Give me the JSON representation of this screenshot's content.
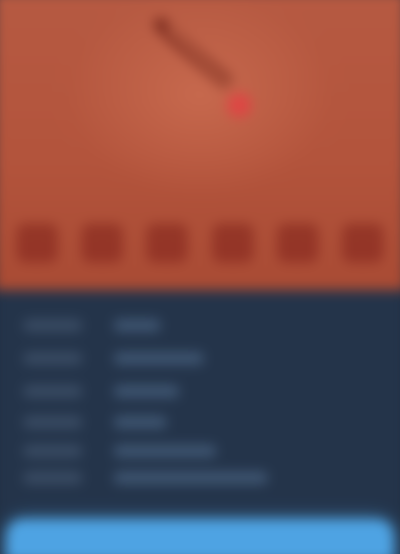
{
  "hero": {
    "title": ""
  },
  "details": {
    "rows": [
      "",
      "",
      "",
      "",
      "",
      ""
    ]
  },
  "action": {
    "label": ""
  },
  "colors": {
    "hero_background": "#b65a42",
    "panel_background": "#24344a",
    "accent": "#4ea3e3",
    "art_stroke": "#7a2a1e",
    "art_tip": "#e04444"
  },
  "icons": {
    "hero_art": "drumstick-icon"
  }
}
